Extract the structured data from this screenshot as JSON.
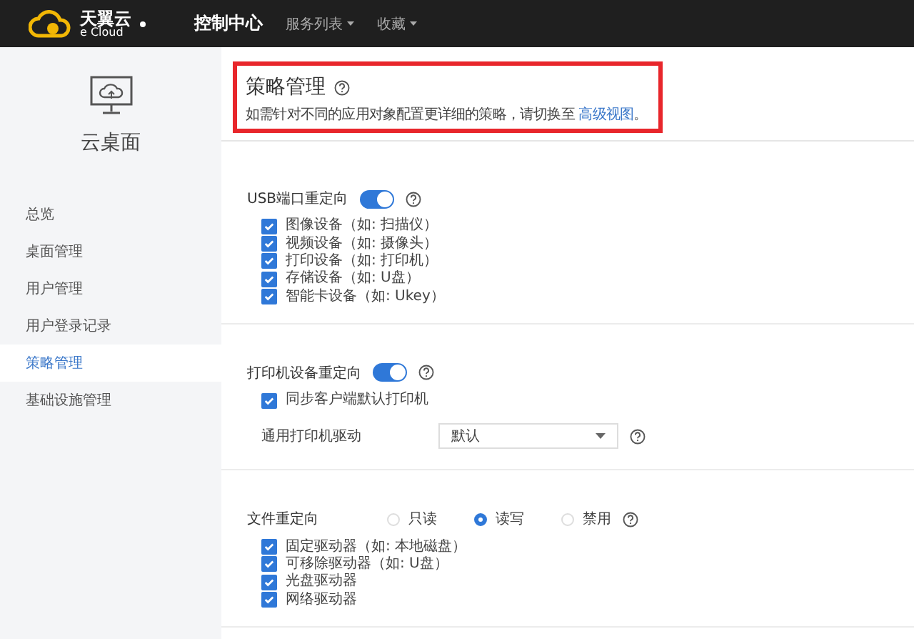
{
  "topbar": {
    "logo_cn": "天翼云",
    "logo_en": "e Cloud",
    "nav": [
      {
        "label": "控制中心",
        "selected": true,
        "dropdown": false
      },
      {
        "label": "服务列表",
        "selected": false,
        "dropdown": true
      },
      {
        "label": "收藏",
        "selected": false,
        "dropdown": true
      }
    ]
  },
  "sidebar": {
    "title": "云桌面",
    "items": [
      {
        "label": "总览",
        "selected": false
      },
      {
        "label": "桌面管理",
        "selected": false
      },
      {
        "label": "用户管理",
        "selected": false
      },
      {
        "label": "用户登录记录",
        "selected": false
      },
      {
        "label": "策略管理",
        "selected": true
      },
      {
        "label": "基础设施管理",
        "selected": false
      }
    ]
  },
  "header": {
    "title": "策略管理",
    "description": "如需针对不同的应用对象配置更详细的策略，请切换至",
    "link": "高级视图",
    "description_end": "。"
  },
  "sections": [
    {
      "kind": "toggle",
      "title": "USB端口重定向",
      "on": true,
      "options": [
        {
          "label": "图像设备（如: 扫描仪）",
          "checked": true
        },
        {
          "label": "视频设备（如: 摄像头）",
          "checked": true
        },
        {
          "label": "打印设备（如: 打印机）",
          "checked": true
        },
        {
          "label": "存储设备（如: U盘）",
          "checked": true
        },
        {
          "label": "智能卡设备（如: Ukey）",
          "checked": true
        }
      ]
    },
    {
      "kind": "toggle",
      "title": "打印机设备重定向",
      "on": true,
      "options": [
        {
          "label": "同步客户端默认打印机",
          "checked": true
        }
      ],
      "select": {
        "label": "通用打印机驱动",
        "value": "默认"
      }
    },
    {
      "kind": "radio",
      "title": "文件重定向",
      "choices": [
        {
          "label": "只读",
          "selected": false
        },
        {
          "label": "读写",
          "selected": true
        },
        {
          "label": "禁用",
          "selected": false
        }
      ],
      "options": [
        {
          "label": "固定驱动器（如: 本地磁盘）",
          "checked": true
        },
        {
          "label": "可移除驱动器（如: U盘）",
          "checked": true
        },
        {
          "label": "光盘驱动器",
          "checked": true
        },
        {
          "label": "网络驱动器",
          "checked": true
        }
      ]
    }
  ]
}
